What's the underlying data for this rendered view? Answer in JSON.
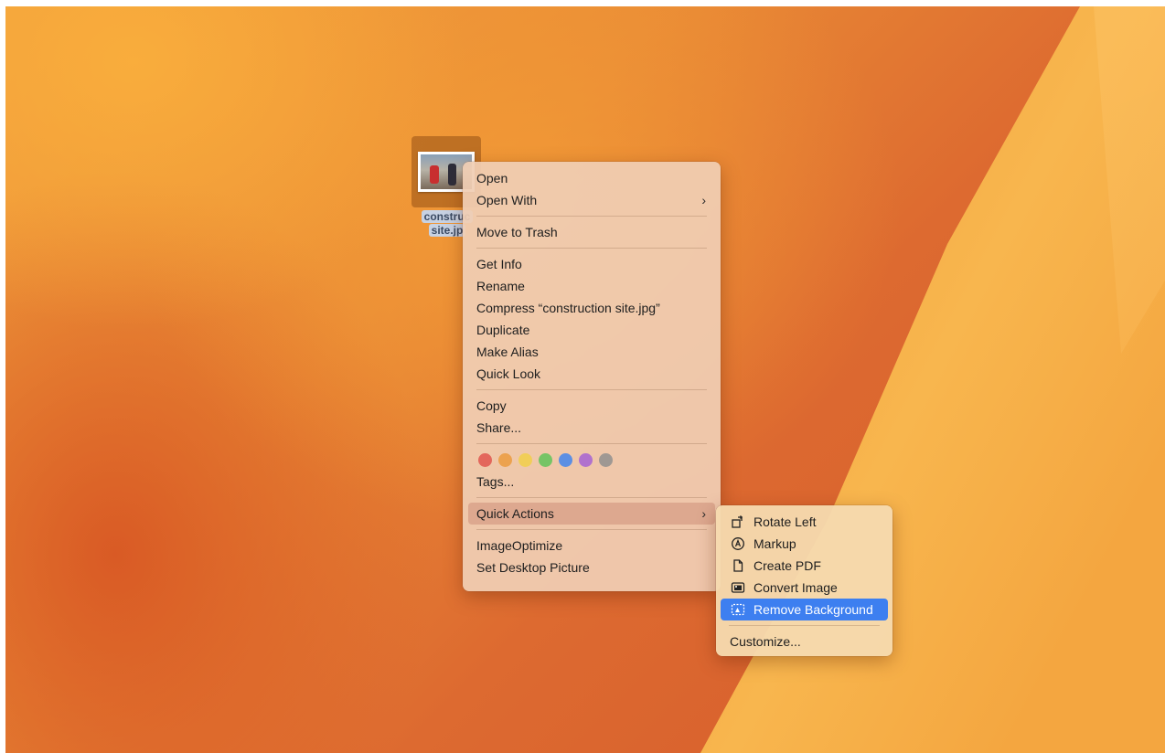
{
  "desktop_file": {
    "label_line1": "construc",
    "label_line2": "site.jp"
  },
  "context_menu": {
    "open": "Open",
    "open_with": "Open With",
    "move_to_trash": "Move to Trash",
    "get_info": "Get Info",
    "rename": "Rename",
    "compress": "Compress “construction site.jpg”",
    "duplicate": "Duplicate",
    "make_alias": "Make Alias",
    "quick_look": "Quick Look",
    "copy": "Copy",
    "share": "Share...",
    "tag_colors": [
      "#e0524a",
      "#eb9a3a",
      "#f2cf45",
      "#5cc357",
      "#3c82ef",
      "#a45fd4",
      "#8e8e8e"
    ],
    "tags": "Tags...",
    "quick_actions": "Quick Actions",
    "image_optimize": "ImageOptimize",
    "set_desktop_picture": "Set Desktop Picture",
    "chevron": "›"
  },
  "quick_actions_submenu": {
    "rotate_left": "Rotate Left",
    "markup": "Markup",
    "create_pdf": "Create PDF",
    "convert_image": "Convert Image",
    "remove_background": "Remove Background",
    "customize": "Customize..."
  }
}
